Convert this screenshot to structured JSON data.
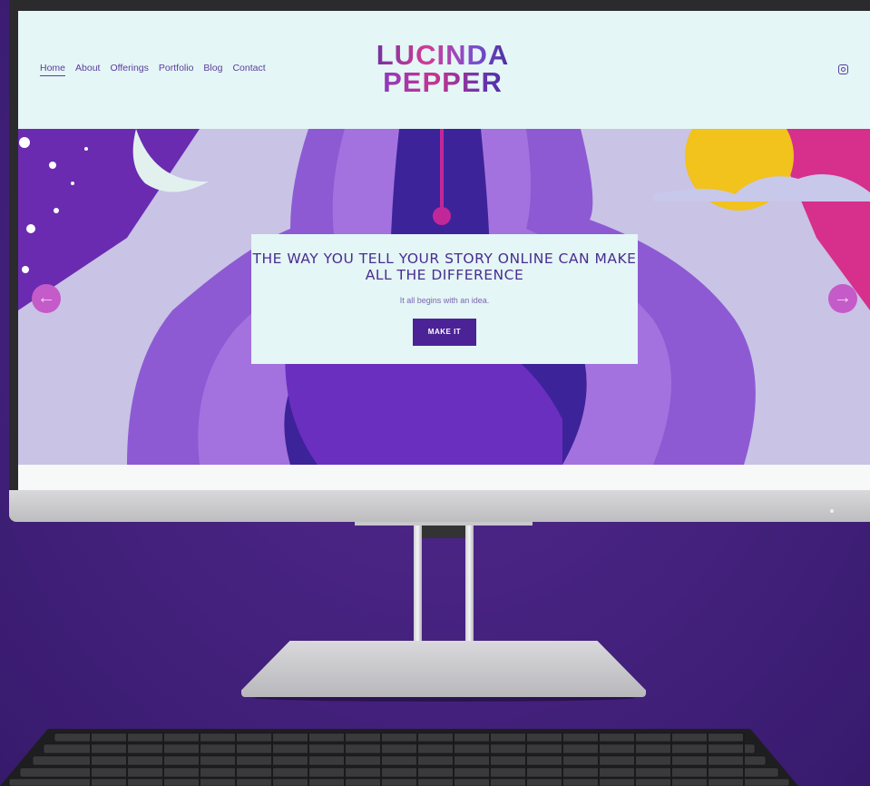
{
  "site": {
    "nav": [
      "Home",
      "About",
      "Offerings",
      "Portfolio",
      "Blog",
      "Contact"
    ],
    "logo_line1": "LUCINDA",
    "logo_line2": "PEPPER",
    "social_icon": "instagram-icon"
  },
  "hero": {
    "title_line1": "THE WAY YOU TELL YOUR STORY ONLINE CAN MAKE",
    "title_line2": "ALL THE DIFFERENCE",
    "subtitle": "It all begins with an idea.",
    "button_label": "MAKE IT",
    "prev_arrow": "←",
    "next_arrow": "→"
  },
  "colors": {
    "background": "#4a2480",
    "header": "#e4f6f5",
    "accent": "#4b2396",
    "arrow": "#c45bc9"
  }
}
